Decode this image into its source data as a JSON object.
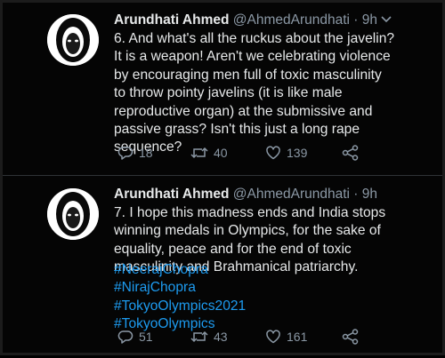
{
  "tweets": [
    {
      "author_name": "Arundhati Ahmed",
      "handle": "@AhmedArundhati",
      "separator": "·",
      "time": "9h",
      "lines": [
        "6. And what's all the ruckus about the javelin?",
        "It is a weapon! Aren't we celebrating violence",
        "by encouraging men full of toxic masculinity",
        "to throw pointy javelins (it is like male",
        "reproductive organ) at the submissive and",
        "passive grass? Isn't this just a long rape",
        "sequence?"
      ],
      "hashtags": [],
      "replies": "18",
      "retweets": "40",
      "likes": "139"
    },
    {
      "author_name": "Arundhati Ahmed",
      "handle": "@AhmedArundhati",
      "separator": "·",
      "time": "9h",
      "lines": [
        "7. I hope this madness ends and India stops",
        "winning medals in Olympics, for the sake of",
        "equality, peace and for the end of toxic",
        "masculinity and Brahmanical patriarchy."
      ],
      "hashtags": [
        "#NeerajChopra",
        "#NirajChopra",
        "#TokyoOlympics2021",
        "#TokyoOlympics"
      ],
      "replies": "51",
      "retweets": "43",
      "likes": "161"
    }
  ],
  "icons": {
    "avatar": "profile-avatar",
    "caret": "chevron-down-icon",
    "reply": "reply-icon",
    "retweet": "retweet-icon",
    "like": "heart-icon",
    "share": "share-icon"
  },
  "colors": {
    "background": "#000000",
    "text": "#e7e9ea",
    "secondary": "#8b98a5",
    "hashtag": "#1d9bf0"
  }
}
